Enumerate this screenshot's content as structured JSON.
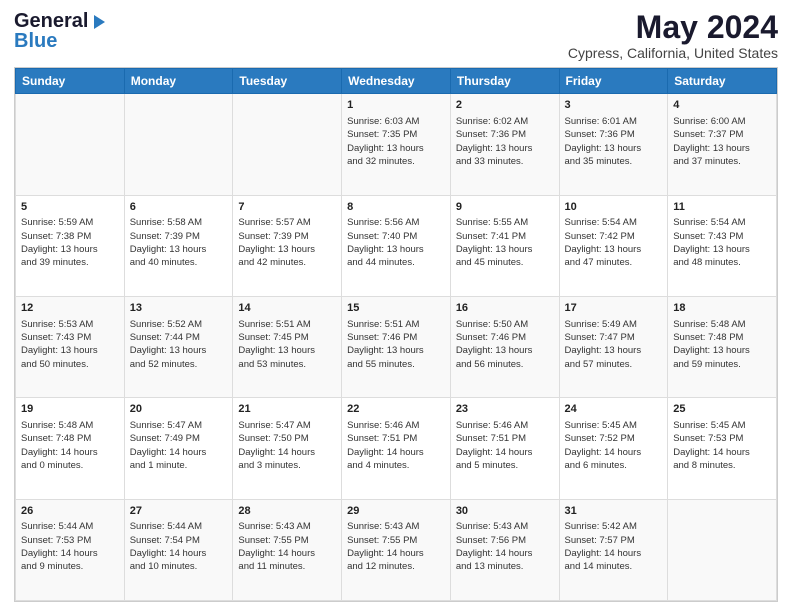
{
  "logo": {
    "general": "General",
    "blue": "Blue"
  },
  "header": {
    "month": "May 2024",
    "location": "Cypress, California, United States"
  },
  "days_of_week": [
    "Sunday",
    "Monday",
    "Tuesday",
    "Wednesday",
    "Thursday",
    "Friday",
    "Saturday"
  ],
  "weeks": [
    {
      "days": [
        {
          "number": "",
          "info": ""
        },
        {
          "number": "",
          "info": ""
        },
        {
          "number": "",
          "info": ""
        },
        {
          "number": "1",
          "info": "Sunrise: 6:03 AM\nSunset: 7:35 PM\nDaylight: 13 hours\nand 32 minutes."
        },
        {
          "number": "2",
          "info": "Sunrise: 6:02 AM\nSunset: 7:36 PM\nDaylight: 13 hours\nand 33 minutes."
        },
        {
          "number": "3",
          "info": "Sunrise: 6:01 AM\nSunset: 7:36 PM\nDaylight: 13 hours\nand 35 minutes."
        },
        {
          "number": "4",
          "info": "Sunrise: 6:00 AM\nSunset: 7:37 PM\nDaylight: 13 hours\nand 37 minutes."
        }
      ]
    },
    {
      "days": [
        {
          "number": "5",
          "info": "Sunrise: 5:59 AM\nSunset: 7:38 PM\nDaylight: 13 hours\nand 39 minutes."
        },
        {
          "number": "6",
          "info": "Sunrise: 5:58 AM\nSunset: 7:39 PM\nDaylight: 13 hours\nand 40 minutes."
        },
        {
          "number": "7",
          "info": "Sunrise: 5:57 AM\nSunset: 7:39 PM\nDaylight: 13 hours\nand 42 minutes."
        },
        {
          "number": "8",
          "info": "Sunrise: 5:56 AM\nSunset: 7:40 PM\nDaylight: 13 hours\nand 44 minutes."
        },
        {
          "number": "9",
          "info": "Sunrise: 5:55 AM\nSunset: 7:41 PM\nDaylight: 13 hours\nand 45 minutes."
        },
        {
          "number": "10",
          "info": "Sunrise: 5:54 AM\nSunset: 7:42 PM\nDaylight: 13 hours\nand 47 minutes."
        },
        {
          "number": "11",
          "info": "Sunrise: 5:54 AM\nSunset: 7:43 PM\nDaylight: 13 hours\nand 48 minutes."
        }
      ]
    },
    {
      "days": [
        {
          "number": "12",
          "info": "Sunrise: 5:53 AM\nSunset: 7:43 PM\nDaylight: 13 hours\nand 50 minutes."
        },
        {
          "number": "13",
          "info": "Sunrise: 5:52 AM\nSunset: 7:44 PM\nDaylight: 13 hours\nand 52 minutes."
        },
        {
          "number": "14",
          "info": "Sunrise: 5:51 AM\nSunset: 7:45 PM\nDaylight: 13 hours\nand 53 minutes."
        },
        {
          "number": "15",
          "info": "Sunrise: 5:51 AM\nSunset: 7:46 PM\nDaylight: 13 hours\nand 55 minutes."
        },
        {
          "number": "16",
          "info": "Sunrise: 5:50 AM\nSunset: 7:46 PM\nDaylight: 13 hours\nand 56 minutes."
        },
        {
          "number": "17",
          "info": "Sunrise: 5:49 AM\nSunset: 7:47 PM\nDaylight: 13 hours\nand 57 minutes."
        },
        {
          "number": "18",
          "info": "Sunrise: 5:48 AM\nSunset: 7:48 PM\nDaylight: 13 hours\nand 59 minutes."
        }
      ]
    },
    {
      "days": [
        {
          "number": "19",
          "info": "Sunrise: 5:48 AM\nSunset: 7:48 PM\nDaylight: 14 hours\nand 0 minutes."
        },
        {
          "number": "20",
          "info": "Sunrise: 5:47 AM\nSunset: 7:49 PM\nDaylight: 14 hours\nand 1 minute."
        },
        {
          "number": "21",
          "info": "Sunrise: 5:47 AM\nSunset: 7:50 PM\nDaylight: 14 hours\nand 3 minutes."
        },
        {
          "number": "22",
          "info": "Sunrise: 5:46 AM\nSunset: 7:51 PM\nDaylight: 14 hours\nand 4 minutes."
        },
        {
          "number": "23",
          "info": "Sunrise: 5:46 AM\nSunset: 7:51 PM\nDaylight: 14 hours\nand 5 minutes."
        },
        {
          "number": "24",
          "info": "Sunrise: 5:45 AM\nSunset: 7:52 PM\nDaylight: 14 hours\nand 6 minutes."
        },
        {
          "number": "25",
          "info": "Sunrise: 5:45 AM\nSunset: 7:53 PM\nDaylight: 14 hours\nand 8 minutes."
        }
      ]
    },
    {
      "days": [
        {
          "number": "26",
          "info": "Sunrise: 5:44 AM\nSunset: 7:53 PM\nDaylight: 14 hours\nand 9 minutes."
        },
        {
          "number": "27",
          "info": "Sunrise: 5:44 AM\nSunset: 7:54 PM\nDaylight: 14 hours\nand 10 minutes."
        },
        {
          "number": "28",
          "info": "Sunrise: 5:43 AM\nSunset: 7:55 PM\nDaylight: 14 hours\nand 11 minutes."
        },
        {
          "number": "29",
          "info": "Sunrise: 5:43 AM\nSunset: 7:55 PM\nDaylight: 14 hours\nand 12 minutes."
        },
        {
          "number": "30",
          "info": "Sunrise: 5:43 AM\nSunset: 7:56 PM\nDaylight: 14 hours\nand 13 minutes."
        },
        {
          "number": "31",
          "info": "Sunrise: 5:42 AM\nSunset: 7:57 PM\nDaylight: 14 hours\nand 14 minutes."
        },
        {
          "number": "",
          "info": ""
        }
      ]
    }
  ]
}
